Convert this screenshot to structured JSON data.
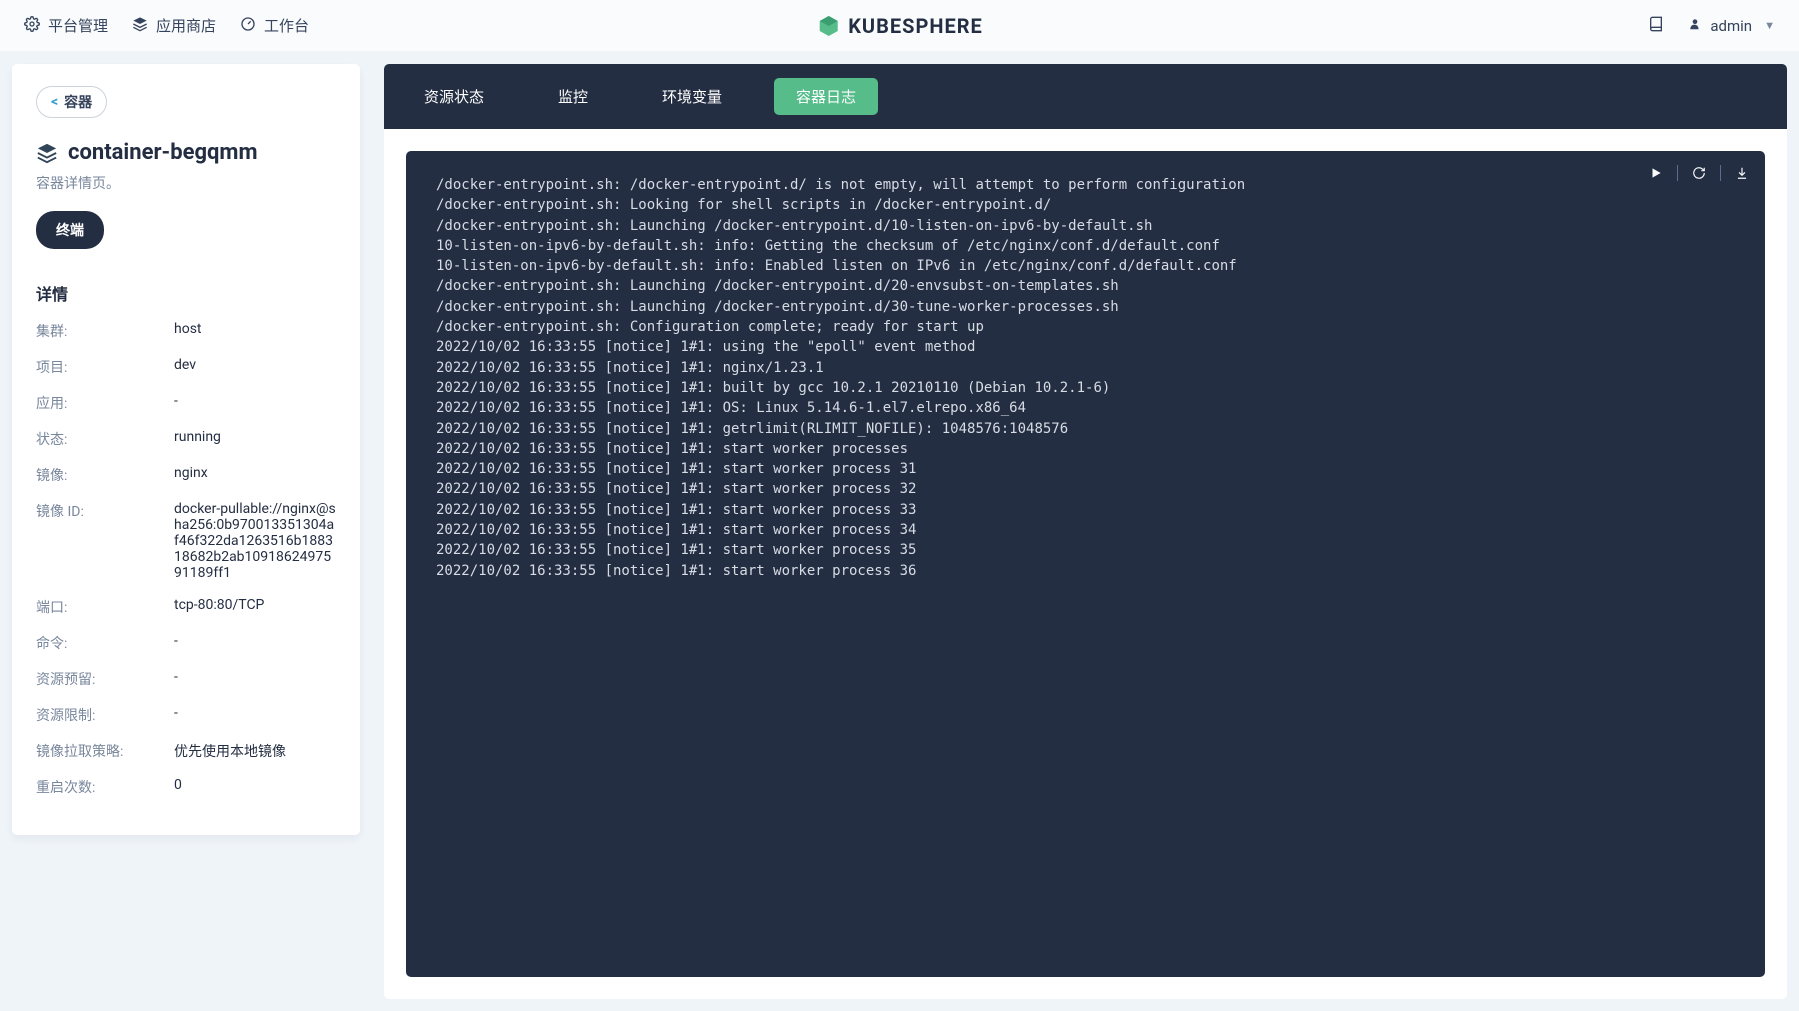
{
  "topbar": {
    "platform": "平台管理",
    "appstore": "应用商店",
    "workbench": "工作台",
    "brand": "KUBESPHERE",
    "username": "admin"
  },
  "sidebar": {
    "back_label": "容器",
    "title": "container-begqmm",
    "subtitle": "容器详情页。",
    "terminal_label": "终端",
    "details_heading": "详情",
    "details": [
      {
        "label": "集群:",
        "value": "host"
      },
      {
        "label": "项目:",
        "value": "dev"
      },
      {
        "label": "应用:",
        "value": "-"
      },
      {
        "label": "状态:",
        "value": "running"
      },
      {
        "label": "镜像:",
        "value": "nginx"
      },
      {
        "label": "镜像 ID:",
        "value": "docker-pullable://nginx@sha256:0b970013351304af46f322da1263516b188318682b2ab10918624975​91189ff1"
      },
      {
        "label": "端口:",
        "value": "tcp-80:80/TCP"
      },
      {
        "label": "命令:",
        "value": "-"
      },
      {
        "label": "资源预留:",
        "value": "-"
      },
      {
        "label": "资源限制:",
        "value": "-"
      },
      {
        "label": "镜像拉取策略:",
        "value": "优先使用本地镜像"
      },
      {
        "label": "重启次数:",
        "value": "0"
      }
    ]
  },
  "tabs": [
    {
      "label": "资源状态",
      "active": false
    },
    {
      "label": "监控",
      "active": false
    },
    {
      "label": "环境变量",
      "active": false
    },
    {
      "label": "容器日志",
      "active": true
    }
  ],
  "log": {
    "lines": [
      "/docker-entrypoint.sh: /docker-entrypoint.d/ is not empty, will attempt to perform configuration",
      "/docker-entrypoint.sh: Looking for shell scripts in /docker-entrypoint.d/",
      "/docker-entrypoint.sh: Launching /docker-entrypoint.d/10-listen-on-ipv6-by-default.sh",
      "10-listen-on-ipv6-by-default.sh: info: Getting the checksum of /etc/nginx/conf.d/default.conf",
      "10-listen-on-ipv6-by-default.sh: info: Enabled listen on IPv6 in /etc/nginx/conf.d/default.conf",
      "/docker-entrypoint.sh: Launching /docker-entrypoint.d/20-envsubst-on-templates.sh",
      "/docker-entrypoint.sh: Launching /docker-entrypoint.d/30-tune-worker-processes.sh",
      "/docker-entrypoint.sh: Configuration complete; ready for start up",
      "2022/10/02 16:33:55 [notice] 1#1: using the \"epoll\" event method",
      "2022/10/02 16:33:55 [notice] 1#1: nginx/1.23.1",
      "2022/10/02 16:33:55 [notice] 1#1: built by gcc 10.2.1 20210110 (Debian 10.2.1-6)",
      "2022/10/02 16:33:55 [notice] 1#1: OS: Linux 5.14.6-1.el7.elrepo.x86_64",
      "2022/10/02 16:33:55 [notice] 1#1: getrlimit(RLIMIT_NOFILE): 1048576:1048576",
      "2022/10/02 16:33:55 [notice] 1#1: start worker processes",
      "2022/10/02 16:33:55 [notice] 1#1: start worker process 31",
      "2022/10/02 16:33:55 [notice] 1#1: start worker process 32",
      "2022/10/02 16:33:55 [notice] 1#1: start worker process 33",
      "2022/10/02 16:33:55 [notice] 1#1: start worker process 34",
      "2022/10/02 16:33:55 [notice] 1#1: start worker process 35",
      "2022/10/02 16:33:55 [notice] 1#1: start worker process 36"
    ]
  }
}
